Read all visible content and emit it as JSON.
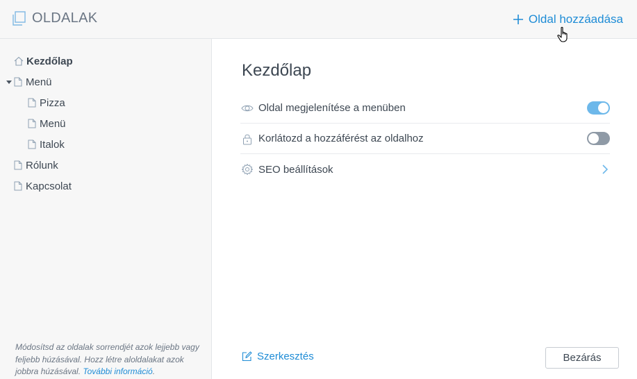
{
  "header": {
    "title": "OLDALAK",
    "add_page_label": "Oldal hozzáadása"
  },
  "sidebar": {
    "items": [
      {
        "label": "Kezdőlap",
        "icon": "home-icon",
        "active": true,
        "level": 0
      },
      {
        "label": "Menü",
        "icon": "doc-icon",
        "expanded": true,
        "level": 0
      },
      {
        "label": "Pizza",
        "icon": "doc-icon",
        "level": 1
      },
      {
        "label": "Menü",
        "icon": "doc-icon",
        "level": 1
      },
      {
        "label": "Italok",
        "icon": "doc-icon",
        "level": 1
      },
      {
        "label": "Rólunk",
        "icon": "doc-icon",
        "level": 0
      },
      {
        "label": "Kapcsolat",
        "icon": "doc-icon",
        "level": 0
      }
    ],
    "help_text": "Módosítsd az oldalak sorrendjét azok lejjebb vagy feljebb húzásával. Hozz létre aloldalakat azok jobbra húzásával.",
    "help_link": "További információ",
    "help_end": "."
  },
  "main": {
    "page_title": "Kezdőlap",
    "settings": [
      {
        "label": "Oldal megjelenítése a menüben",
        "icon": "eye-icon",
        "control": "toggle",
        "value": true
      },
      {
        "label": "Korlátozd a hozzáférést az oldalhoz",
        "icon": "lock-icon",
        "control": "toggle",
        "value": false
      },
      {
        "label": "SEO beállítások",
        "icon": "gear-icon",
        "control": "chevron"
      }
    ],
    "edit_label": "Szerkesztés",
    "close_label": "Bezárás"
  },
  "colors": {
    "accent": "#1e8cd6",
    "toggle_on": "#6db8ea",
    "toggle_off": "#8f9aa6",
    "text": "#3d4752",
    "sidebar_bg": "#f7f7f7"
  }
}
